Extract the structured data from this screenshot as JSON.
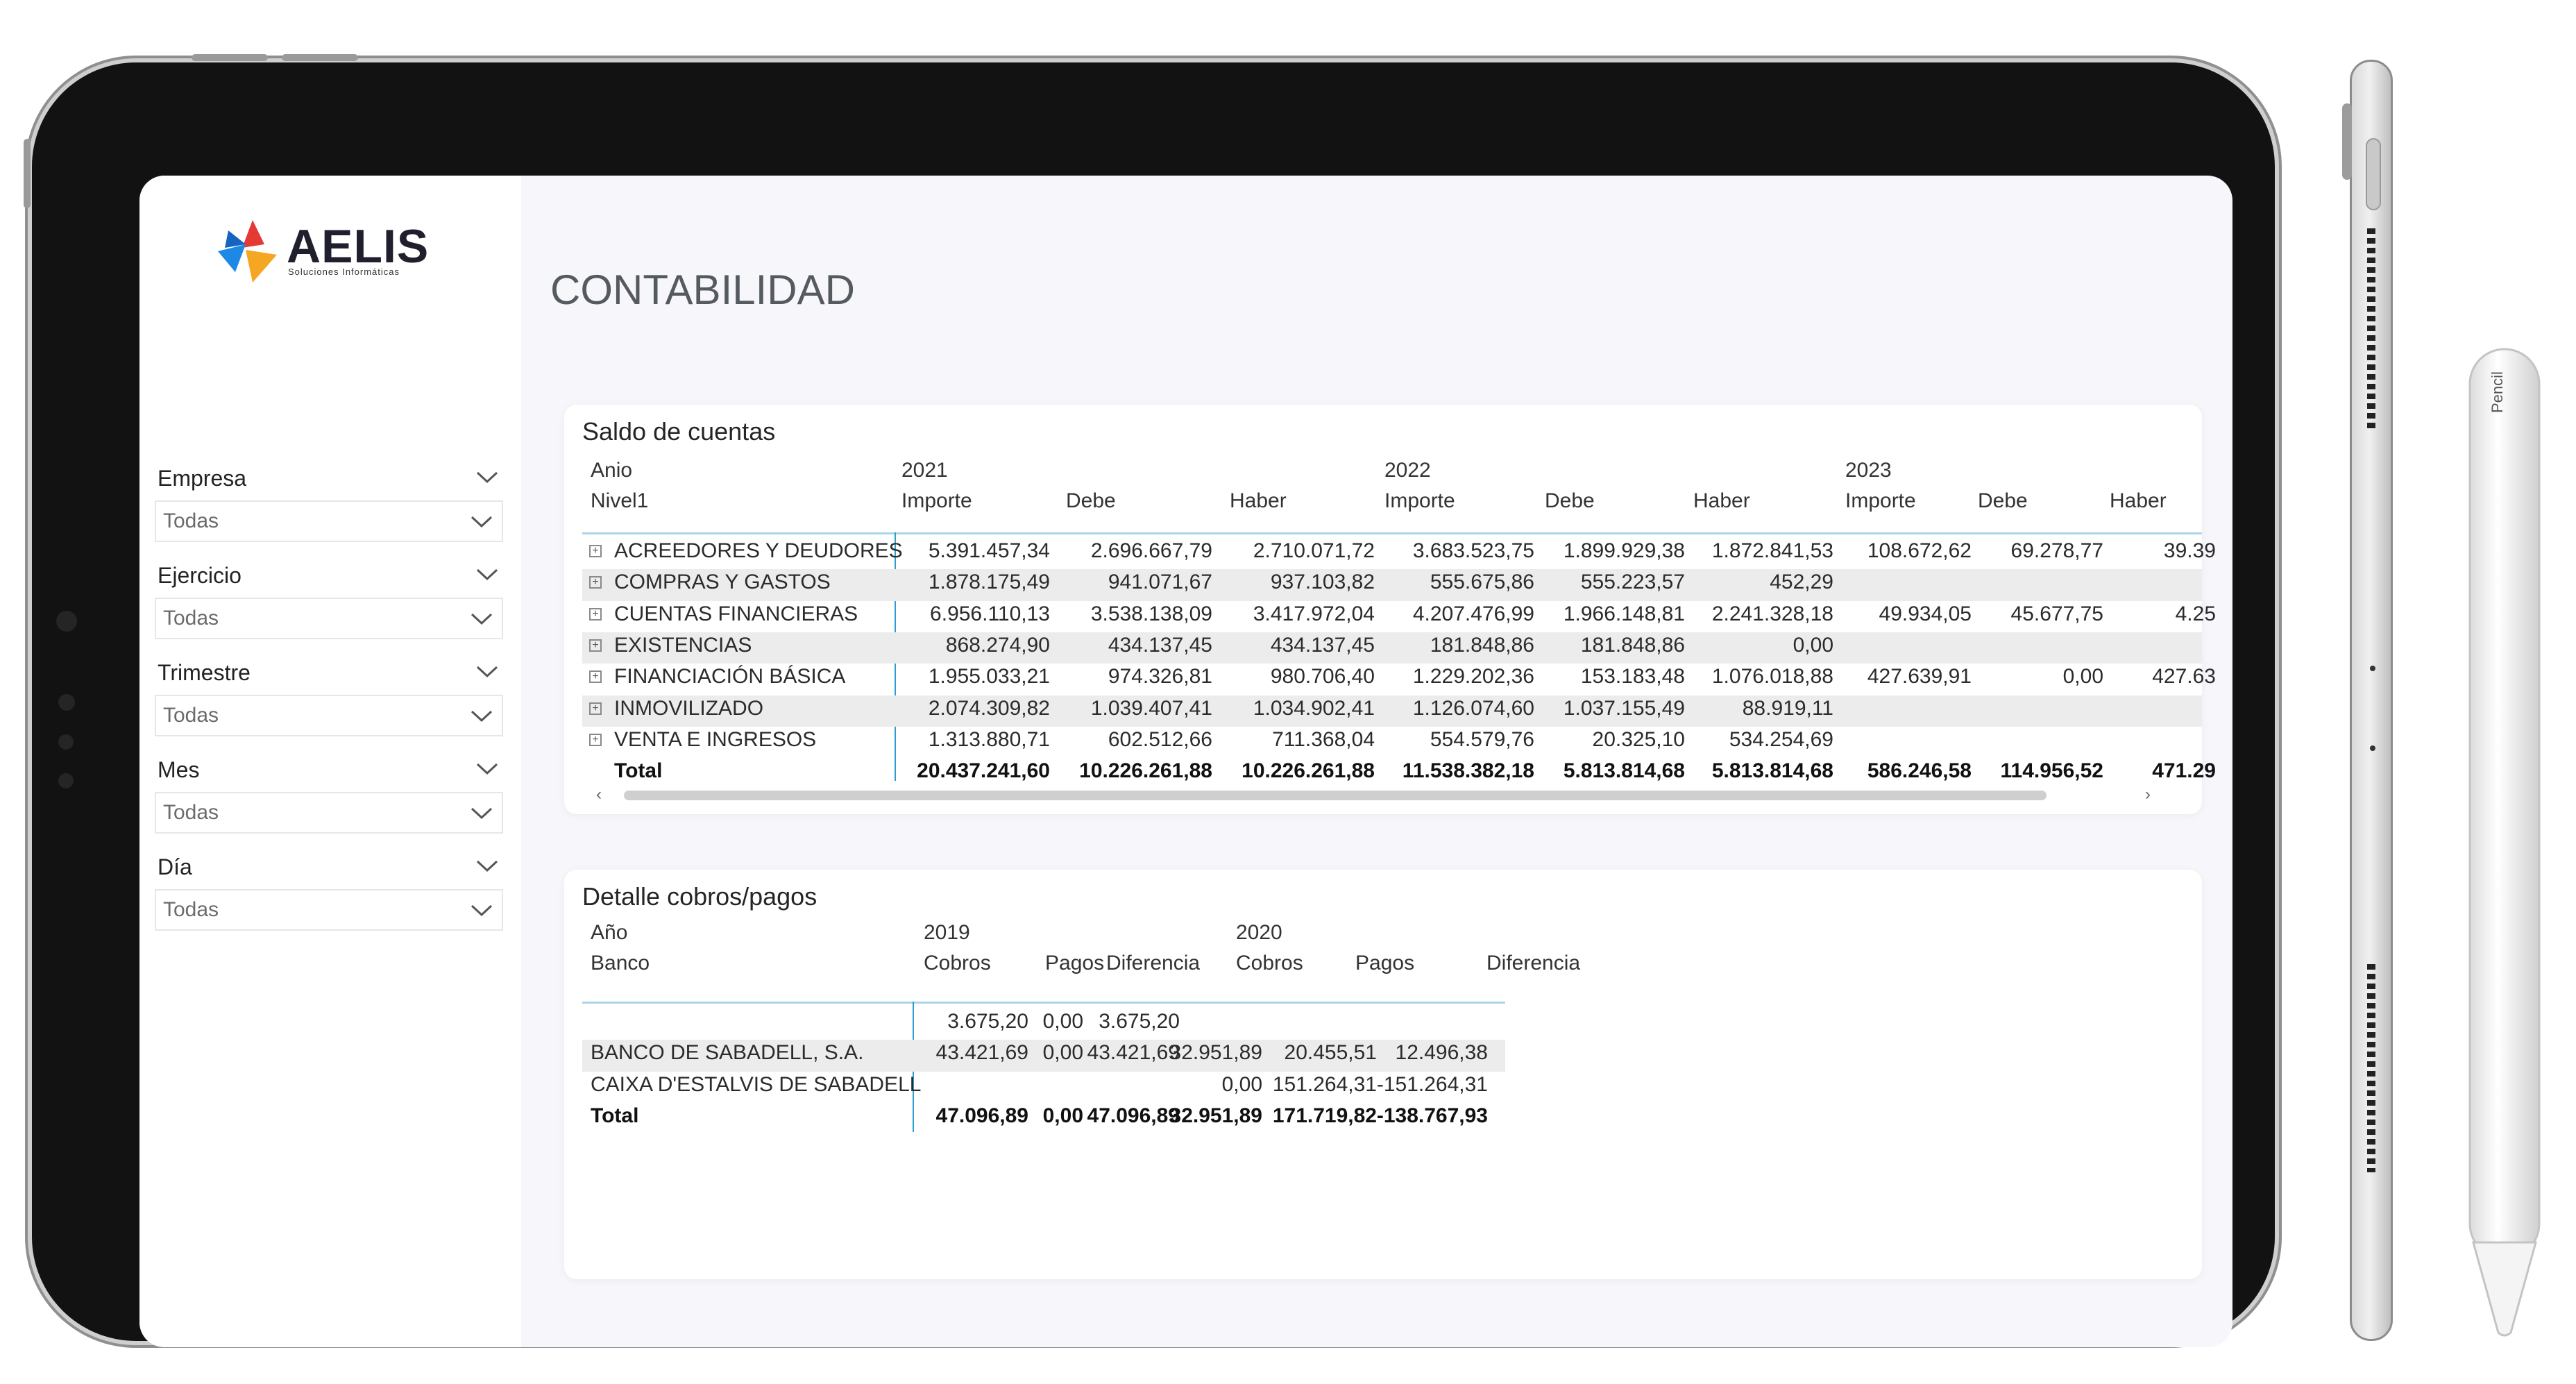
{
  "brand": {
    "name": "AELIS",
    "tagline": "Soluciones Informáticas",
    "colors": {
      "blue": "#1e88e5",
      "orange": "#f5a623",
      "red": "#e53935",
      "accent": "#2e9fd0"
    }
  },
  "page": {
    "title": "CONTABILIDAD"
  },
  "slicers": [
    {
      "label": "Empresa",
      "value": "Todas"
    },
    {
      "label": "Ejercicio",
      "value": "Todas"
    },
    {
      "label": "Trimestre",
      "value": "Todas"
    },
    {
      "label": "Mes",
      "value": "Todas"
    },
    {
      "label": "Día",
      "value": "Todas"
    }
  ],
  "saldo": {
    "title": "Saldo de cuentas",
    "row_header_top": "Anio",
    "row_header_bottom": "Nivel1",
    "years": [
      "2021",
      "2022",
      "2023"
    ],
    "measures": [
      "Importe",
      "Debe",
      "Haber"
    ],
    "rows": [
      {
        "name": "ACREEDORES Y DEUDORES",
        "values": [
          "5.391.457,34",
          "2.696.667,79",
          "2.710.071,72",
          "3.683.523,75",
          "1.899.929,38",
          "1.872.841,53",
          "108.672,62",
          "69.278,77",
          "39.39"
        ]
      },
      {
        "name": "COMPRAS Y GASTOS",
        "values": [
          "1.878.175,49",
          "941.071,67",
          "937.103,82",
          "555.675,86",
          "555.223,57",
          "452,29",
          "",
          "",
          ""
        ]
      },
      {
        "name": "CUENTAS FINANCIERAS",
        "values": [
          "6.956.110,13",
          "3.538.138,09",
          "3.417.972,04",
          "4.207.476,99",
          "1.966.148,81",
          "2.241.328,18",
          "49.934,05",
          "45.677,75",
          "4.25"
        ]
      },
      {
        "name": "EXISTENCIAS",
        "values": [
          "868.274,90",
          "434.137,45",
          "434.137,45",
          "181.848,86",
          "181.848,86",
          "0,00",
          "",
          "",
          ""
        ]
      },
      {
        "name": "FINANCIACIÓN BÁSICA",
        "values": [
          "1.955.033,21",
          "974.326,81",
          "980.706,40",
          "1.229.202,36",
          "153.183,48",
          "1.076.018,88",
          "427.639,91",
          "0,00",
          "427.63"
        ]
      },
      {
        "name": "INMOVILIZADO",
        "values": [
          "2.074.309,82",
          "1.039.407,41",
          "1.034.902,41",
          "1.126.074,60",
          "1.037.155,49",
          "88.919,11",
          "",
          "",
          ""
        ]
      },
      {
        "name": "VENTA E INGRESOS",
        "values": [
          "1.313.880,71",
          "602.512,66",
          "711.368,04",
          "554.579,76",
          "20.325,10",
          "534.254,69",
          "",
          "",
          ""
        ]
      }
    ],
    "total": {
      "name": "Total",
      "values": [
        "20.437.241,60",
        "10.226.261,88",
        "10.226.261,88",
        "11.538.382,18",
        "5.813.814,68",
        "5.813.814,68",
        "586.246,58",
        "114.956,52",
        "471.29"
      ]
    },
    "scroll": {
      "left_arrow": "‹",
      "right_arrow": "›"
    }
  },
  "detalle": {
    "title": "Detalle cobros/pagos",
    "row_header_top": "Año",
    "row_header_bottom": "Banco",
    "years": [
      "2019",
      "2020"
    ],
    "measures": [
      "Cobros",
      "Pagos",
      "Diferencia"
    ],
    "rows": [
      {
        "name": "",
        "values": [
          "3.675,20",
          "0,00",
          "3.675,20",
          "",
          "",
          ""
        ]
      },
      {
        "name": "BANCO DE SABADELL, S.A.",
        "values": [
          "43.421,69",
          "0,00",
          "43.421,69",
          "32.951,89",
          "20.455,51",
          "12.496,38"
        ]
      },
      {
        "name": "CAIXA D'ESTALVIS DE SABADELL",
        "values": [
          "",
          "",
          "",
          "0,00",
          "151.264,31",
          "-151.264,31"
        ]
      }
    ],
    "total": {
      "name": "Total",
      "values": [
        "47.096,89",
        "0,00",
        "47.096,89",
        "32.951,89",
        "171.719,82",
        "-138.767,93"
      ]
    }
  },
  "pencil": {
    "brand": "Pencil"
  }
}
